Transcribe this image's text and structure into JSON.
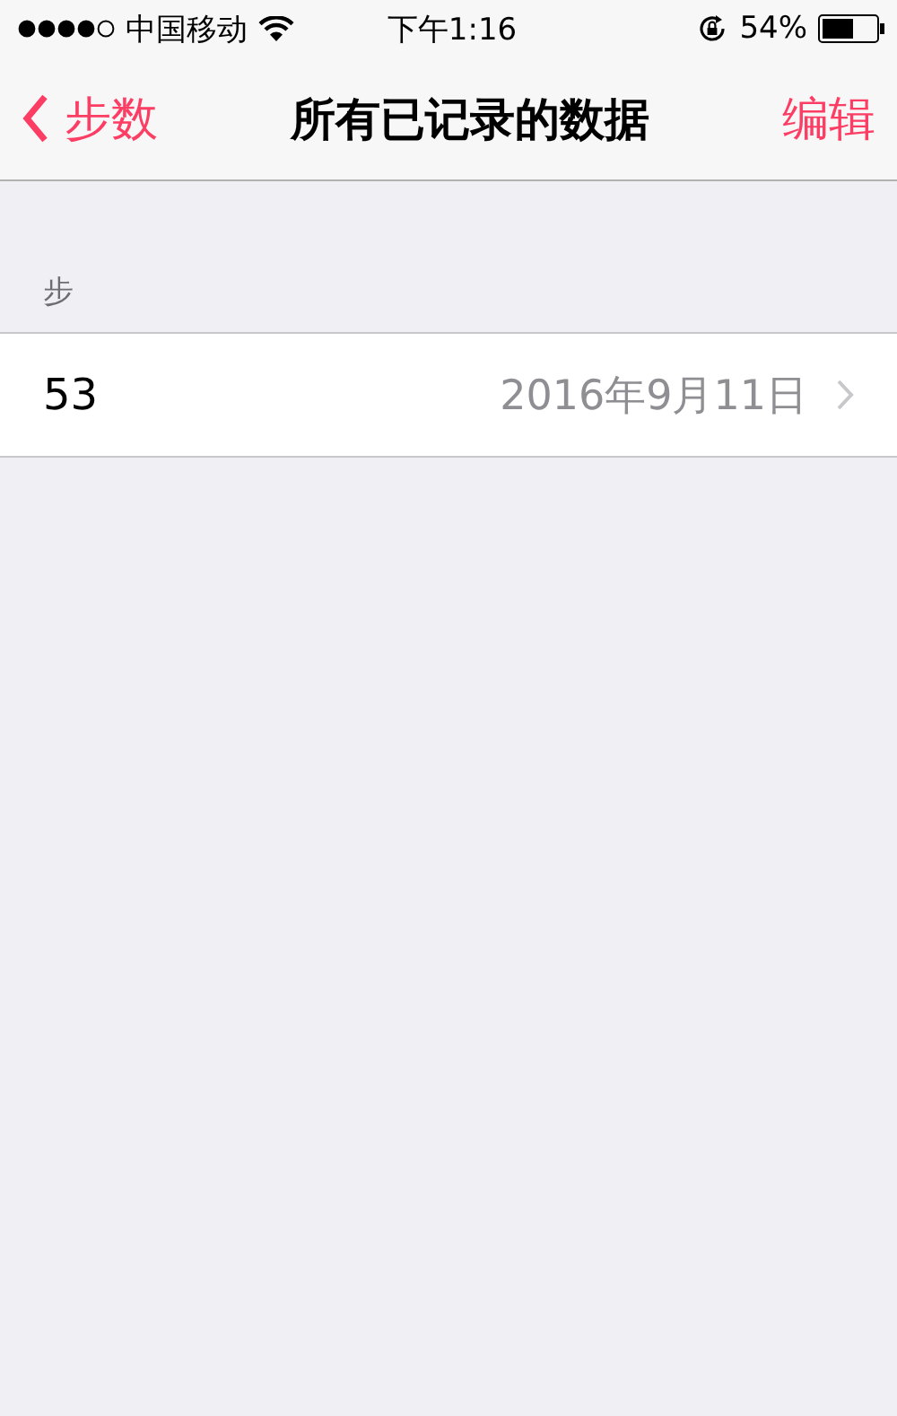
{
  "status_bar": {
    "carrier": "中国移动",
    "time": "下午1:16",
    "battery": "54%"
  },
  "nav_bar": {
    "back": "步数",
    "title": "所有已记录的数据",
    "action": "编辑"
  },
  "section": {
    "header": "步",
    "rows": [
      {
        "value": "53",
        "date": "2016年9月11日"
      }
    ]
  }
}
